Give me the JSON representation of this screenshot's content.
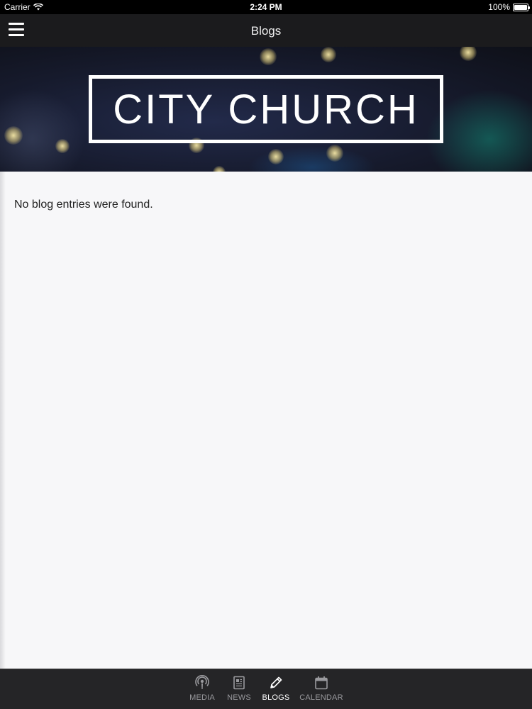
{
  "status_bar": {
    "carrier": "Carrier",
    "time": "2:24 PM",
    "battery": "100%",
    "battery_level": 1.0
  },
  "nav": {
    "title": "Blogs",
    "menu_icon": "hamburger-menu-icon"
  },
  "hero": {
    "logo_text": "CITY CHURCH"
  },
  "content": {
    "empty_message": "No blog entries were found."
  },
  "tabs": [
    {
      "label": "MEDIA",
      "icon": "podcast-icon",
      "active": false
    },
    {
      "label": "NEWS",
      "icon": "newspaper-icon",
      "active": false
    },
    {
      "label": "BLOGS",
      "icon": "pencil-icon",
      "active": true
    },
    {
      "label": "CALENDAR",
      "icon": "calendar-icon",
      "active": false
    }
  ],
  "colors": {
    "nav_bg": "#1b1b1d",
    "tab_bg": "#252527",
    "content_bg": "#f7f7f9",
    "tab_inactive": "#9a9a9e",
    "tab_active": "#ffffff"
  }
}
